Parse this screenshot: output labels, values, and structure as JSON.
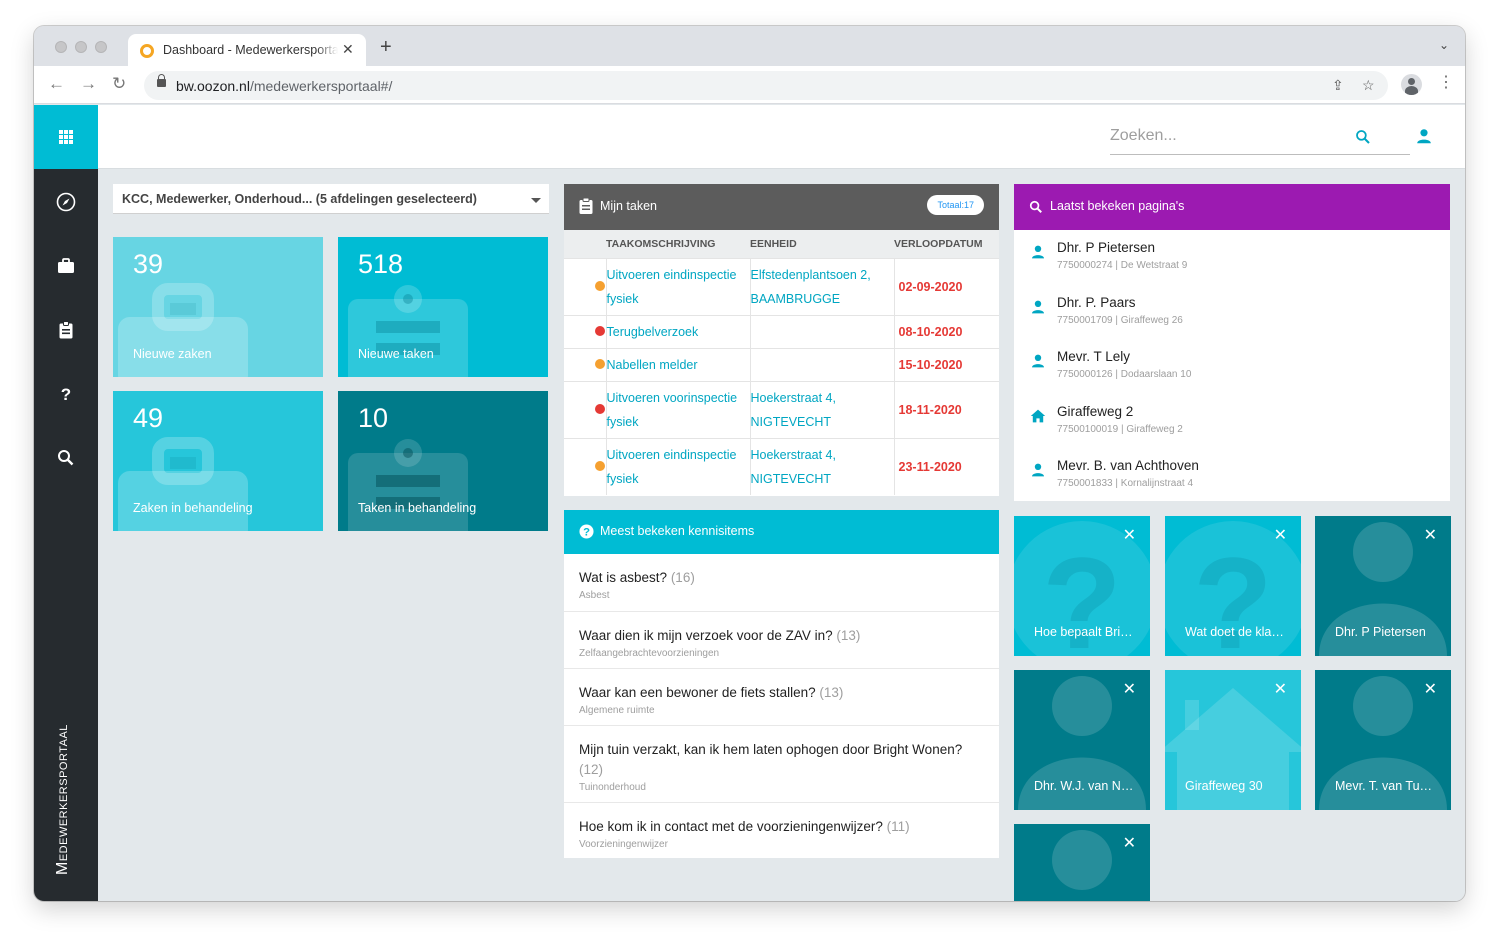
{
  "browser": {
    "tab_title": "Dashboard - Medewerkersportaal",
    "url_domain": "bw.oozon.nl",
    "url_path": "/medewerkersportaal#/"
  },
  "app": {
    "brand": "Medewerkersportaal",
    "search_placeholder": "Zoeken...",
    "department_selector": "KCC, Medewerker, Onderhoud... (5 afdelingen geselecteerd)"
  },
  "colors": {
    "accent": "#00bcd4",
    "sidebar": "#262b2f",
    "tasks_header": "#5c5c5c",
    "recent_header": "#9c1ab1",
    "teal_dark": "#007b8a",
    "teal_mid": "#00b5cc",
    "teal_light": "#67d5e3",
    "overdue_red": "#e53935",
    "orange": "#f5a030"
  },
  "stats": [
    {
      "value": "39",
      "label": "Nieuwe zaken",
      "icon": "briefcase-icon"
    },
    {
      "value": "518",
      "label": "Nieuwe taken",
      "icon": "clipboard-icon"
    },
    {
      "value": "49",
      "label": "Zaken in behandeling",
      "icon": "briefcase-icon"
    },
    {
      "value": "10",
      "label": "Taken in behandeling",
      "icon": "clipboard-icon"
    }
  ],
  "tasks": {
    "title": "Mijn taken",
    "total_badge": "Totaal:17",
    "columns": [
      "TAAKOMSCHRIJVING",
      "EENHEID",
      "VERLOOPDATUM"
    ],
    "rows": [
      {
        "status": "orange",
        "description": "Uitvoeren eindinspectie fysiek",
        "unit": "Elfstedenplantsoen 2, BAAMBRUGGE",
        "due": "02-09-2020"
      },
      {
        "status": "red",
        "description": "Terugbelverzoek",
        "unit": "",
        "due": "08-10-2020"
      },
      {
        "status": "orange",
        "description": "Nabellen melder",
        "unit": "",
        "due": "15-10-2020"
      },
      {
        "status": "red",
        "description": "Uitvoeren voorinspectie fysiek",
        "unit": "Hoekerstraat 4, NIGTEVECHT",
        "due": "18-11-2020"
      },
      {
        "status": "orange",
        "description": "Uitvoeren eindinspectie fysiek",
        "unit": "Hoekerstraat 4, NIGTEVECHT",
        "due": "23-11-2020"
      }
    ]
  },
  "knowledge": {
    "title": "Meest bekeken kennisitems",
    "items": [
      {
        "question": "Wat is asbest?",
        "count": "(16)",
        "category": "Asbest"
      },
      {
        "question": "Waar dien ik mijn verzoek voor de ZAV in?",
        "count": "(13)",
        "category": "Zelfaangebrachtevoorzieningen"
      },
      {
        "question": "Waar kan een bewoner de fiets stallen?",
        "count": "(13)",
        "category": "Algemene ruimte"
      },
      {
        "question": "Mijn tuin verzakt, kan ik hem laten ophogen door Bright Wonen?",
        "count": "(12)",
        "category": "Tuinonderhoud"
      },
      {
        "question": "Hoe kom ik in contact met de voorzieningenwijzer?",
        "count": "(11)",
        "category": "Voorzieningenwijzer"
      }
    ]
  },
  "recent": {
    "title": "Laatst bekeken pagina's",
    "items": [
      {
        "icon": "person-icon",
        "name": "Dhr. P Pietersen",
        "sub": "7750000274 | De Wetstraat 9"
      },
      {
        "icon": "person-icon",
        "name": "Dhr. P. Paars",
        "sub": "7750001709 | Giraffeweg 26"
      },
      {
        "icon": "person-icon",
        "name": "Mevr. T Lely",
        "sub": "7750000126 | Dodaarslaan 10"
      },
      {
        "icon": "home-icon",
        "name": "Giraffeweg 2",
        "sub": "77500100019 | Giraffeweg 2"
      },
      {
        "icon": "person-icon",
        "name": "Mevr. B. van Achthoven",
        "sub": "7750001833 | Kornalijnstraat 4"
      }
    ]
  },
  "favorites": [
    {
      "type": "question",
      "label": "Hoe bepaalt Bright Wonen",
      "close": "✕"
    },
    {
      "type": "question",
      "label": "Wat doet de klantenservice",
      "close": "✕"
    },
    {
      "type": "person",
      "label": "Dhr. P Pietersen",
      "close": "✕"
    },
    {
      "type": "person",
      "label": "Dhr. W.J. van Nijkerk",
      "close": "✕"
    },
    {
      "type": "home",
      "label": "Giraffeweg 30",
      "close": "✕"
    },
    {
      "type": "person",
      "label": "Mevr. T. van Turnhout",
      "close": "✕"
    },
    {
      "type": "person",
      "label": "",
      "close": "✕"
    }
  ]
}
